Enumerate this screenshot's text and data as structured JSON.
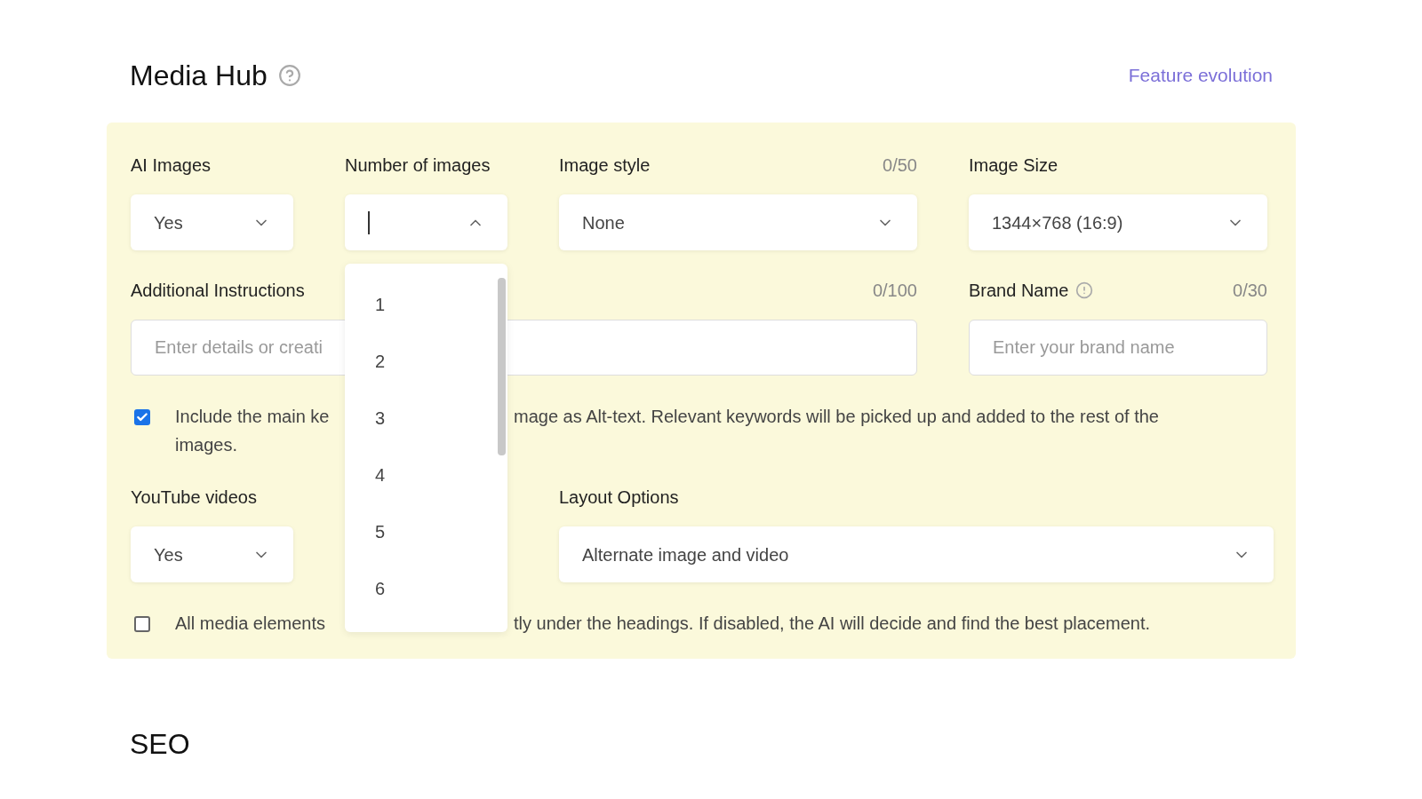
{
  "title": "Media Hub",
  "feature_link": "Feature evolution",
  "ai_images": {
    "label": "AI Images",
    "value": "Yes"
  },
  "number_of_images": {
    "label": "Number of images",
    "open": true,
    "options": [
      "1",
      "2",
      "3",
      "4",
      "5",
      "6"
    ]
  },
  "image_style": {
    "label": "Image style",
    "counter": "0/50",
    "value": "None"
  },
  "image_size": {
    "label": "Image Size",
    "value": "1344×768 (16:9)"
  },
  "additional_instructions": {
    "label": "Additional Instructions",
    "counter": "0/100",
    "placeholder": "Enter details or creati"
  },
  "brand_name": {
    "label": "Brand Name",
    "counter": "0/30",
    "placeholder": "Enter your brand name"
  },
  "alt_text_option": {
    "checked": true,
    "text_parts": [
      "Include the main ke",
      "mage as Alt-text. Relevant keywords will be picked up and added to the rest of the",
      "images."
    ]
  },
  "youtube_videos": {
    "label": "YouTube videos",
    "value": "Yes"
  },
  "layout_options": {
    "label": "Layout Options",
    "value": "Alternate image and video"
  },
  "placement_option": {
    "checked": false,
    "text_parts": [
      "All media elements",
      "tly under the headings. If disabled, the AI will decide and find the best placement."
    ]
  },
  "next_section": "SEO"
}
